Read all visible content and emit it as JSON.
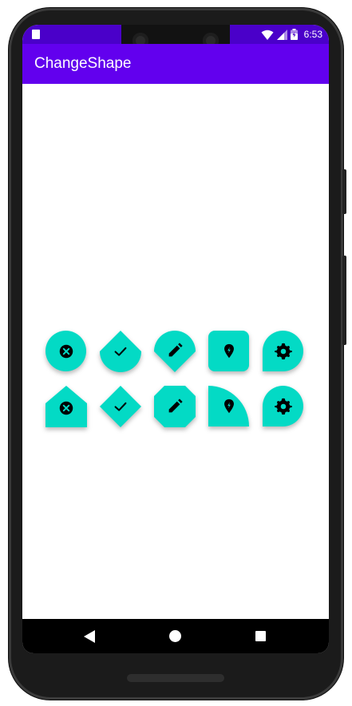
{
  "status_bar": {
    "time": "6:53",
    "icons": [
      "sd-card-icon",
      "wifi-icon",
      "signal-icon",
      "battery-icon"
    ],
    "color": "#4a00c9"
  },
  "app_bar": {
    "title": "ChangeShape",
    "color": "#6200ee"
  },
  "fab_color": "#03dac5",
  "fab_grid": {
    "row1": [
      {
        "icon": "cancel-icon",
        "shape": "circle"
      },
      {
        "icon": "check-icon",
        "shape": "diamond-round-bottom"
      },
      {
        "icon": "edit-icon",
        "shape": "round-with-cut-corner"
      },
      {
        "icon": "location-icon",
        "shape": "rounded-square"
      },
      {
        "icon": "settings-icon",
        "shape": "teardrop"
      }
    ],
    "row2": [
      {
        "icon": "cancel-icon",
        "shape": "pentagon-cut-top"
      },
      {
        "icon": "check-icon",
        "shape": "diamond"
      },
      {
        "icon": "edit-icon",
        "shape": "octagon"
      },
      {
        "icon": "location-icon",
        "shape": "quarter-round"
      },
      {
        "icon": "settings-icon",
        "shape": "teardrop"
      }
    ]
  },
  "nav_bar": {
    "buttons": [
      "back",
      "home",
      "recents"
    ]
  }
}
